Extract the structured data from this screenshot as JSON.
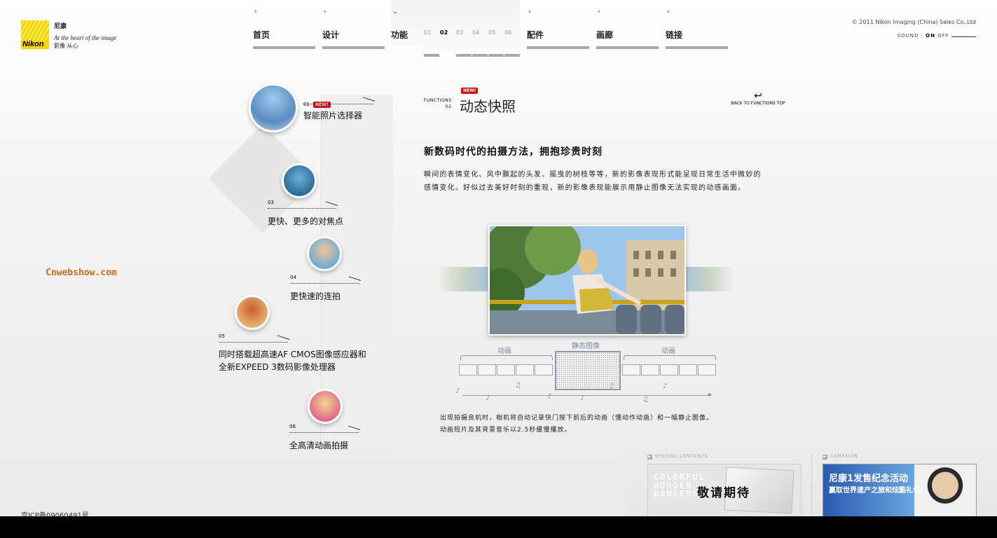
{
  "logo": {
    "brand": "Nikon",
    "cn": "尼康",
    "tagline": "At the heart of the image",
    "sub": "影像·从心"
  },
  "nav": [
    {
      "label": "首页"
    },
    {
      "label": "设计"
    },
    {
      "label": "功能"
    },
    {
      "label": "配件"
    },
    {
      "label": "画廊"
    },
    {
      "label": "链接"
    }
  ],
  "subnav": [
    "01",
    "02",
    "03",
    "04",
    "05",
    "06"
  ],
  "copyright": "© 2011 Nikon Imaging (China) Sales Co.,Ltd",
  "sound": {
    "label": "SOUND :",
    "on": "ON",
    "off": "OFF"
  },
  "new_badge": "NEW!",
  "functions": [
    {
      "num": "01",
      "label": "智能照片选择器"
    },
    {
      "num": "03",
      "label": "更快、更多的对焦点"
    },
    {
      "num": "04",
      "label": "更快速的连拍"
    },
    {
      "num": "05",
      "label": "同时搭载超高速AF CMOS图像感应器和",
      "label2": "全新EXPEED 3数码影像处理器"
    },
    {
      "num": "06",
      "label": "全高清动画拍摄"
    }
  ],
  "watermark": "Cnwebshow.com",
  "icp": "京ICP备09060491号",
  "main": {
    "section_label": "FUNCTIONS",
    "section_num": "02",
    "title": "动态快照",
    "back": "BACK TO FUNCTIONS TOP",
    "heading": "新数码时代的拍摄方法，拥抱珍贵时刻",
    "para": "瞬间的表情变化、风中飘起的头发、摇曳的树枝等等，新的影像表现形式能呈现日常生活中微妙的感情变化。好似过去美好时刻的重现，新的影像表现能展示用静止图像无法实现的动感画面。",
    "diagram": {
      "left": "动画",
      "center": "静态图像",
      "right": "动画"
    },
    "caption1": "出现拍摄良机时，相机将自动记录快门按下前后的动画（慢动作动画）和一幅静止图像。",
    "caption2": "动画短片及其背景音乐以2.5秒缓慢播放。"
  },
  "banners": {
    "special_label": "SPECIAL CONTENTS",
    "special_text": "COLORFUL WONDER DANCERS",
    "special_big": "敬请期待",
    "campaign_label": "CAMPAIGN",
    "campaign_t1": "尼康1发售纪念活动",
    "campaign_t2": "赢取世界遗产之旅和炫酷礼包！"
  }
}
